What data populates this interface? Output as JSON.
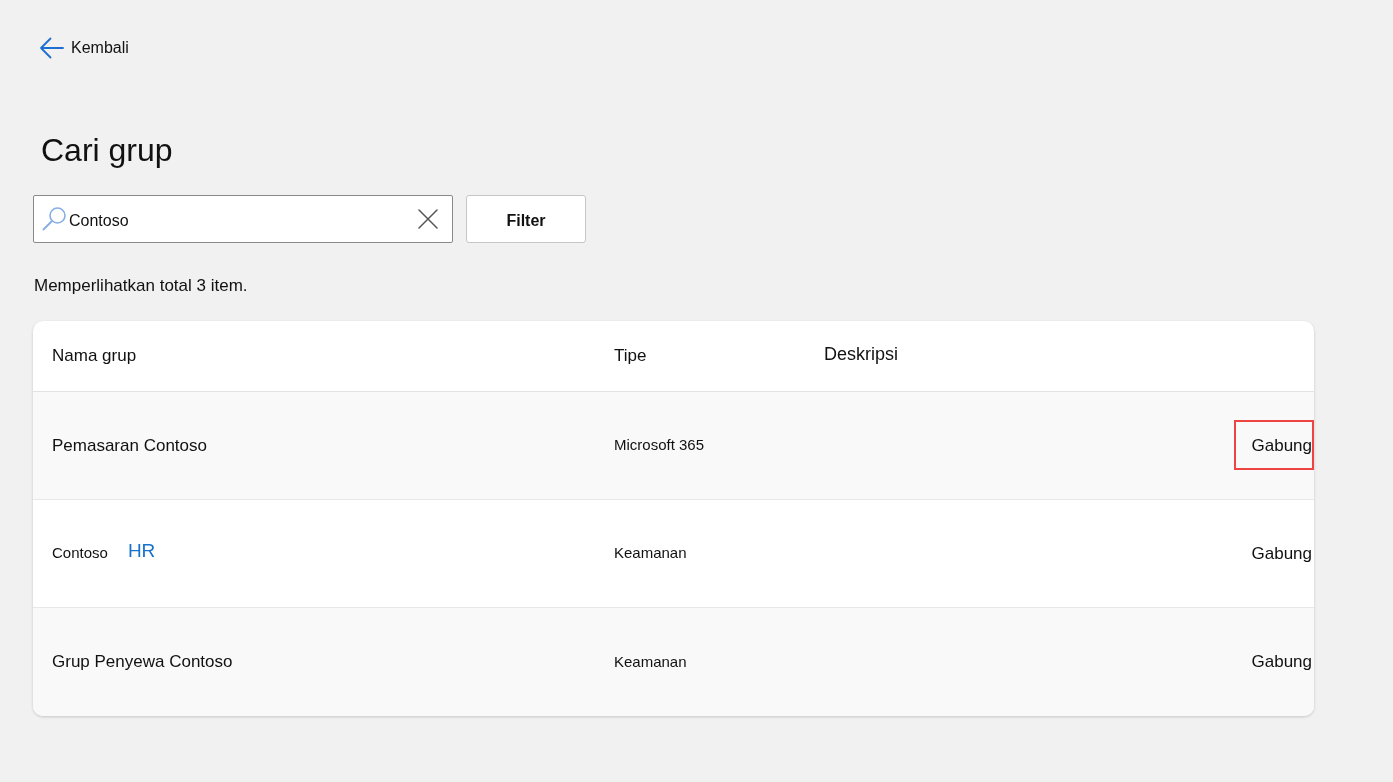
{
  "back_link": {
    "label": "Kembali"
  },
  "title": "Cari grup",
  "search": {
    "value": "Contoso"
  },
  "filter_button": {
    "label": "Filter"
  },
  "result_summary": "Memperlihatkan total 3 item.",
  "table": {
    "columns": [
      "Nama grup",
      "Tipe",
      "Deskripsi"
    ],
    "rows": [
      {
        "name": "Pemasaran Contoso",
        "type": "Microsoft 365",
        "action": "Gabung",
        "highlighted": true
      },
      {
        "name": "Contoso",
        "link": "HR",
        "type": "Keamanan",
        "action": "Gabung",
        "highlighted": false
      },
      {
        "name": "Grup Penyewa Contoso",
        "type": "Keamanan",
        "action": "Gabung",
        "highlighted": false
      }
    ]
  }
}
